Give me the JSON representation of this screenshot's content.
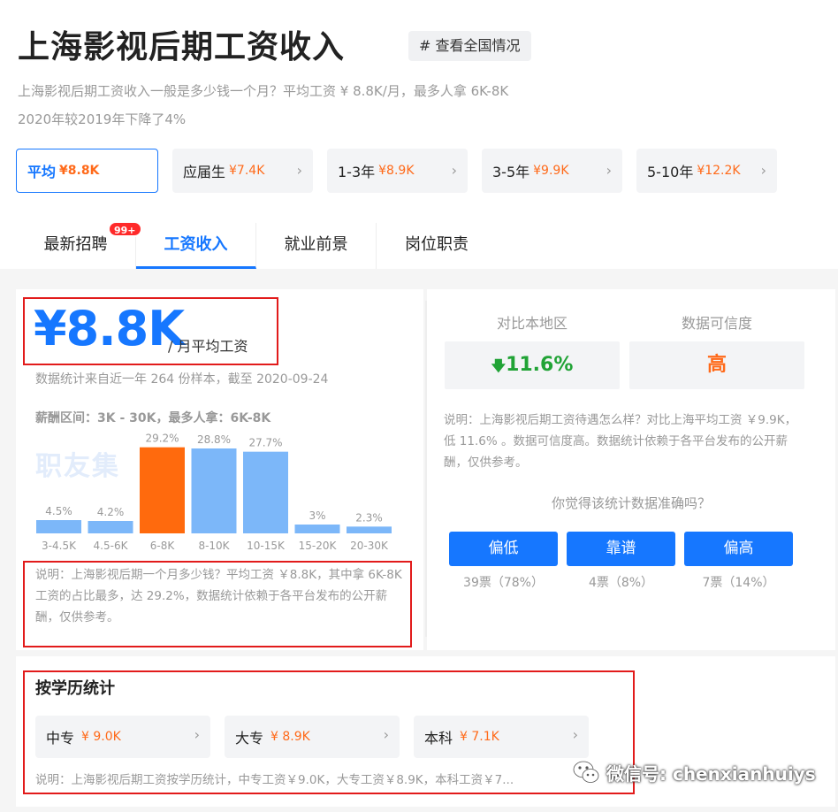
{
  "header": {
    "title": "上海影视后期工资收入",
    "national_button": "# 查看全国情况",
    "desc_line1": "上海影视后期工资收入一般是多少钱一个月？平均工资 ¥ 8.8K/月，最多人拿 6K-8K",
    "desc_line2": "2020年较2019年下降了4%"
  },
  "experience_pills": [
    {
      "label": "平均",
      "salary": "¥8.8K",
      "active": true
    },
    {
      "label": "应届生",
      "salary": "¥7.4K",
      "active": false
    },
    {
      "label": "1-3年",
      "salary": "¥8.9K",
      "active": false
    },
    {
      "label": "3-5年",
      "salary": "¥9.9K",
      "active": false
    },
    {
      "label": "5-10年",
      "salary": "¥12.2K",
      "active": false
    }
  ],
  "tabs": [
    {
      "label": "最新招聘",
      "badge": "99+"
    },
    {
      "label": "工资收入",
      "active": true
    },
    {
      "label": "就业前景"
    },
    {
      "label": "岗位职责"
    }
  ],
  "summary": {
    "salary": "¥8.8K",
    "unit": "/ 月平均工资",
    "sample": "数据统计来自近一年 264 份样本，截至 2020-09-24",
    "range": "薪酬区间：3K - 30K，最多人拿：6K-8K",
    "watermark": "职友集",
    "note": "说明：上海影视后期一个月多少钱？平均工资 ￥8.8K，其中拿 6K-8K 工资的占比最多，达 29.2%，数据统计依赖于各平台发布的公开薪酬，仅供参考。"
  },
  "chart_data": {
    "type": "bar",
    "categories": [
      "3-4.5K",
      "4.5-6K",
      "6-8K",
      "8-10K",
      "10-15K",
      "15-20K",
      "20-30K"
    ],
    "values": [
      4.5,
      4.2,
      29.2,
      28.8,
      27.7,
      3,
      2.3
    ],
    "value_labels": [
      "4.5%",
      "4.2%",
      "29.2%",
      "28.8%",
      "27.7%",
      "3%",
      "2.3%"
    ],
    "highlight_index": 2,
    "colors": {
      "normal": "#7cb7f9",
      "highlight": "#ff6a0d"
    },
    "ylim": [
      0,
      30
    ]
  },
  "comparison": {
    "local_label": "对比本地区",
    "local_value": "11.6%",
    "local_arrow": "down-arrow-icon",
    "trust_label": "数据可信度",
    "trust_value": "高",
    "note": "说明：上海影视后期工资待遇怎么样？对比上海平均工资 ￥9.9K，低 11.6% 。数据可信度高。数据统计依赖于各平台发布的公开薪酬，仅供参考。",
    "question": "你觉得该统计数据准确吗？",
    "votes": [
      {
        "label": "偏低",
        "count": "39票（78%）"
      },
      {
        "label": "靠谱",
        "count": "4票（8%）"
      },
      {
        "label": "偏高",
        "count": "7票（14%）"
      }
    ]
  },
  "education": {
    "title": "按学历统计",
    "items": [
      {
        "label": "中专",
        "salary": "¥ 9.0K"
      },
      {
        "label": "大专",
        "salary": "¥ 8.9K"
      },
      {
        "label": "本科",
        "salary": "¥ 7.1K"
      }
    ],
    "note": "说明：上海影视后期工资按学历统计，中专工资￥9.0K，大专工资￥8.9K，本科工资￥7..."
  },
  "watermark_overlay": {
    "text": "微信号: chenxianhuiys"
  },
  "colors": {
    "primary": "#1677ff",
    "accent_orange": "#ff6a1a",
    "green": "#21a336",
    "annotation_red": "#e21b1b"
  }
}
